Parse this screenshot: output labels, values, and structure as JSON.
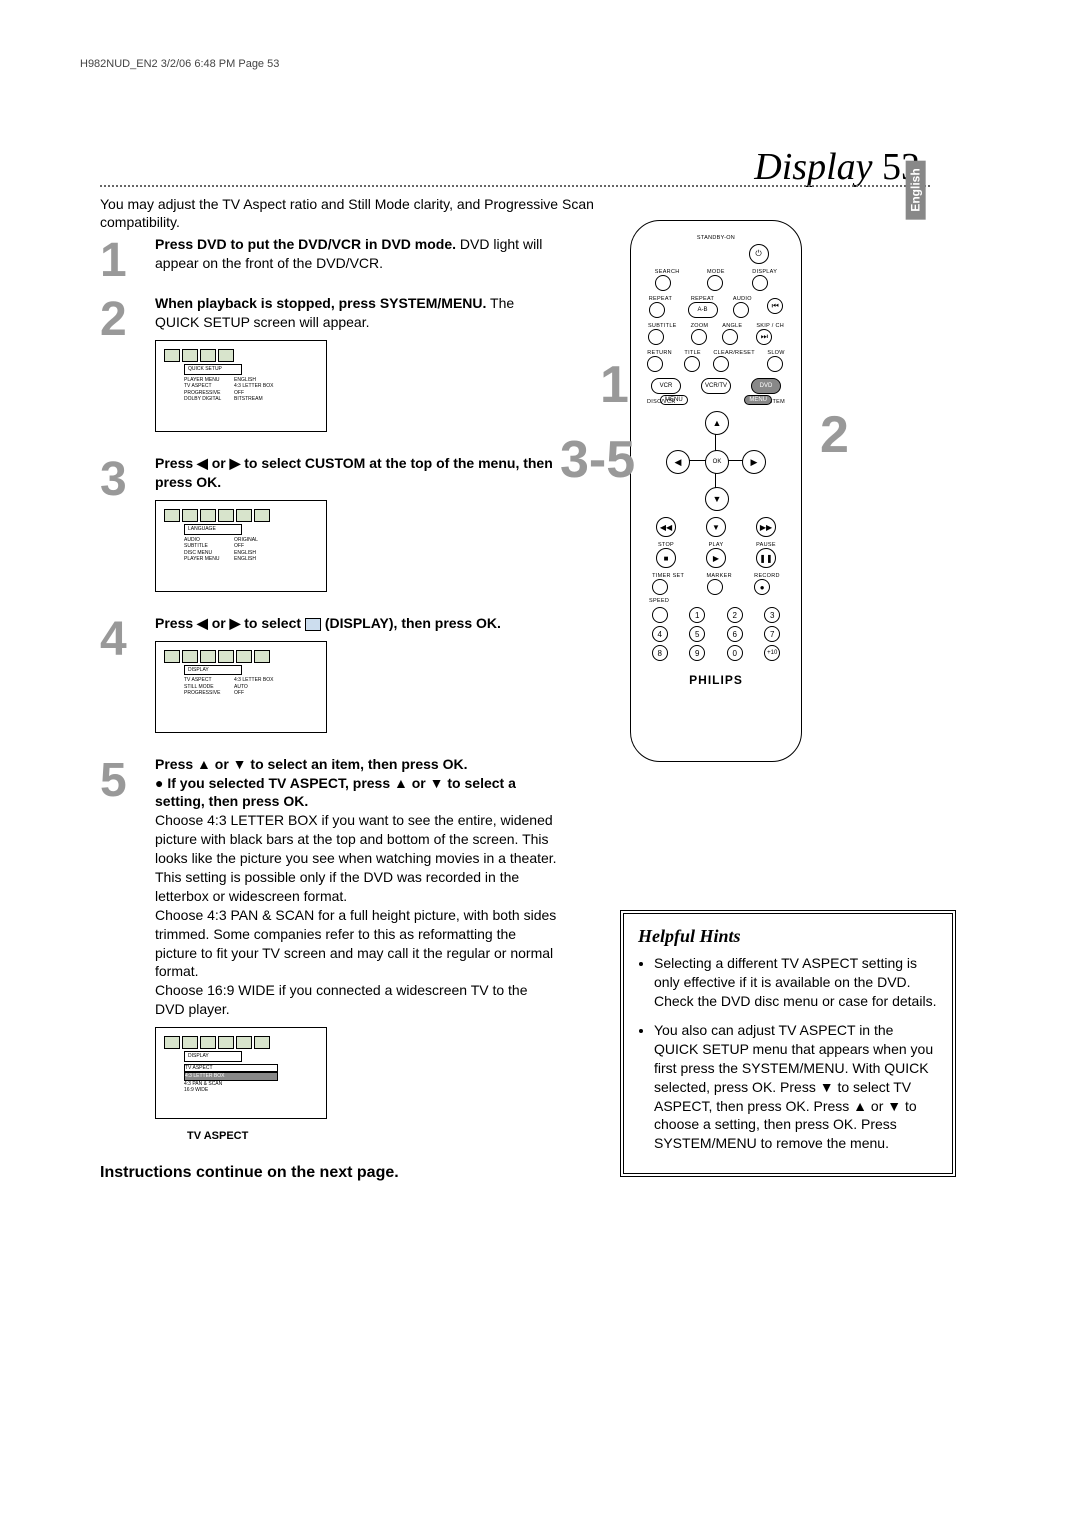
{
  "header": "H982NUD_EN2  3/2/06  6:48 PM  Page 53",
  "page_title_word": "Display",
  "page_number": "53",
  "english_tab": "English",
  "intro": "You may adjust the TV Aspect ratio and Still Mode clarity, and Progressive Scan compatibility.",
  "steps": {
    "s1": {
      "num": "1",
      "bold": "Press DVD to put the DVD/VCR in DVD mode.",
      "rest": " DVD light will appear on the front of the DVD/VCR."
    },
    "s2": {
      "num": "2",
      "bold": "When playback is stopped, press SYSTEM/MENU.",
      "rest": " The QUICK SETUP screen will appear."
    },
    "s3": {
      "num": "3",
      "bold": "Press ◀ or ▶ to select CUSTOM at the top of the menu, then press OK."
    },
    "s4": {
      "num": "4",
      "bold_pre": "Press ◀ or ▶ to select ",
      "bold_mid": " (DISPLAY), then press OK."
    },
    "s5": {
      "num": "5",
      "bold_line1": "Press ▲ or ▼ to select an item, then press OK.",
      "bold_line2": "● If you selected TV ASPECT, press ▲ or ▼ to select a setting, then press OK.",
      "para1": "Choose 4:3 LETTER BOX if you want to see the entire, widened picture with black bars at the top and bottom of the screen. This looks like the picture you see when watching movies in a theater.  This setting is possible only if the DVD was recorded in the letterbox or widescreen format.",
      "para2": "Choose 4:3 PAN & SCAN for a full height picture, with both sides trimmed. Some companies refer to this as reformatting the picture to fit your TV screen and may call it the regular or normal format.",
      "para3": "Choose 16:9 WIDE if you connected a widescreen TV to the DVD player.",
      "caption": "TV ASPECT"
    }
  },
  "screen2": {
    "header": "QUICK SETUP",
    "rows": [
      [
        "PLAYER MENU",
        "ENGLISH"
      ],
      [
        "TV ASPECT",
        "4:3 LETTER BOX"
      ],
      [
        "PROGRESSIVE",
        "OFF"
      ],
      [
        "DOLBY DIGITAL",
        "BITSTREAM"
      ]
    ]
  },
  "screen3": {
    "header": "LANGUAGE",
    "rows": [
      [
        "AUDIO",
        "ORIGINAL"
      ],
      [
        "SUBTITLE",
        "OFF"
      ],
      [
        "DISC MENU",
        "ENGLISH"
      ],
      [
        "PLAYER MENU",
        "ENGLISH"
      ]
    ]
  },
  "screen4": {
    "header": "DISPLAY",
    "rows": [
      [
        "TV ASPECT",
        "4:3 LETTER BOX"
      ],
      [
        "STILL MODE",
        "AUTO"
      ],
      [
        "PROGRESSIVE",
        "OFF"
      ]
    ]
  },
  "screen5": {
    "header": "DISPLAY",
    "sub": "TV ASPECT",
    "rows": [
      [
        "4:3 LETTER BOX",
        ""
      ],
      [
        "4:3 PAN & SCAN",
        ""
      ],
      [
        "16:9 WIDE",
        ""
      ]
    ]
  },
  "remote": {
    "standby": "STANDBY-ON",
    "row1": [
      "SEARCH",
      "MODE",
      "DISPLAY"
    ],
    "row2": [
      "REPEAT",
      "REPEAT",
      "AUDIO"
    ],
    "row2b": "A-B",
    "row3": [
      "SUBTITLE",
      "ZOOM",
      "ANGLE",
      "SKIP / CH"
    ],
    "row4": [
      "RETURN",
      "TITLE",
      "CLEAR/RESET",
      "SLOW"
    ],
    "row5": [
      "VCR",
      "VCR/TV",
      "DVD"
    ],
    "row5b": [
      "DISC/VCR",
      "SYSTEM"
    ],
    "menuL": "MENU",
    "menuR": "MENU",
    "ok": "OK",
    "row6": [
      "STOP",
      "PLAY",
      "PAUSE"
    ],
    "row7": [
      "TIMER SET",
      "MARKER",
      "RECORD"
    ],
    "speed": "SPEED",
    "nums": [
      "1",
      "2",
      "3",
      "4",
      "5",
      "6",
      "7",
      "8",
      "9",
      "0",
      "+10"
    ],
    "brand": "PHILIPS"
  },
  "callouts": {
    "c1": "1",
    "c2": "2",
    "c35": "3-5"
  },
  "hints": {
    "title": "Helpful Hints",
    "items": [
      "Selecting a different TV ASPECT setting is only effective if it is available on the DVD. Check the DVD disc menu or case for details.",
      "You also can adjust TV ASPECT in the QUICK SETUP menu that appears when you first press the SYSTEM/MENU. With QUICK selected, press OK. Press ▼ to select TV ASPECT, then press OK. Press ▲ or ▼ to choose a setting, then press OK. Press SYSTEM/MENU to remove the menu."
    ]
  },
  "continue": "Instructions continue on the next page."
}
